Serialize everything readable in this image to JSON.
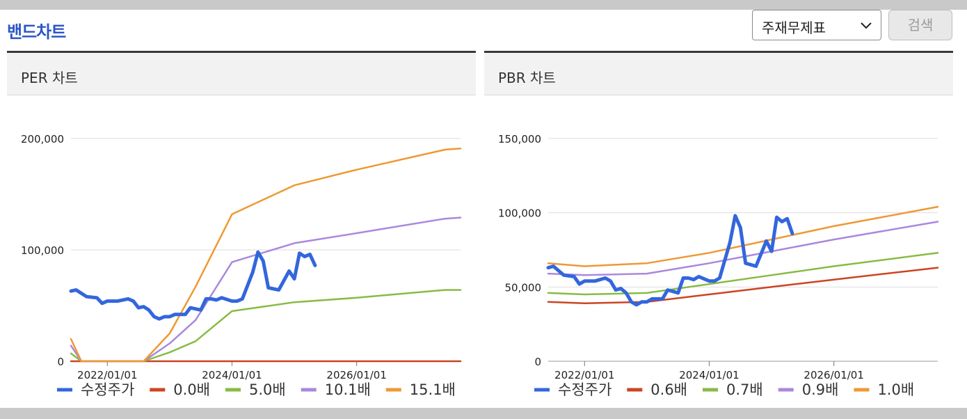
{
  "header": {
    "title": "밴드차트",
    "select_value": "주재무제표",
    "search_label": "검색"
  },
  "colors": {
    "price": "#3366dd",
    "band1": "#cc4422",
    "band2": "#88bb44",
    "band3": "#aa88dd",
    "band4": "#ee9933"
  },
  "chart_data": [
    {
      "type": "line",
      "title": "PER 차트",
      "x_ticks": [
        "2022/01/01",
        "2024/01/01",
        "2026/01/01"
      ],
      "y_ticks": [
        "0",
        "100,000",
        "200,000"
      ],
      "ylim": [
        0,
        200000
      ],
      "xlim": [
        "2021-06",
        "2027-09"
      ],
      "grid": true,
      "legend_position": "bottom",
      "series": [
        {
          "name": "수정주가",
          "color_key": "price",
          "points": [
            [
              "2021-06",
              63000
            ],
            [
              "2021-07",
              64000
            ],
            [
              "2021-08",
              61000
            ],
            [
              "2021-09",
              58000
            ],
            [
              "2021-11",
              57000
            ],
            [
              "2021-12",
              52000
            ],
            [
              "2022-01",
              54000
            ],
            [
              "2022-03",
              54000
            ],
            [
              "2022-05",
              56000
            ],
            [
              "2022-06",
              54000
            ],
            [
              "2022-07",
              48000
            ],
            [
              "2022-08",
              49000
            ],
            [
              "2022-09",
              46000
            ],
            [
              "2022-10",
              40000
            ],
            [
              "2022-11",
              38000
            ],
            [
              "2022-12",
              40000
            ],
            [
              "2023-01",
              40000
            ],
            [
              "2023-02",
              42000
            ],
            [
              "2023-04",
              42000
            ],
            [
              "2023-05",
              48000
            ],
            [
              "2023-06",
              47000
            ],
            [
              "2023-07",
              46000
            ],
            [
              "2023-08",
              56000
            ],
            [
              "2023-09",
              56000
            ],
            [
              "2023-10",
              55000
            ],
            [
              "2023-11",
              57000
            ],
            [
              "2024-01",
              54000
            ],
            [
              "2024-02",
              54000
            ],
            [
              "2024-03",
              56000
            ],
            [
              "2024-05",
              80000
            ],
            [
              "2024-06",
              98000
            ],
            [
              "2024-07",
              90000
            ],
            [
              "2024-08",
              66000
            ],
            [
              "2024-09",
              65000
            ],
            [
              "2024-10",
              64000
            ],
            [
              "2024-12",
              81000
            ],
            [
              "2025-01",
              74000
            ],
            [
              "2025-02",
              97000
            ],
            [
              "2025-03",
              94000
            ],
            [
              "2025-04",
              96000
            ],
            [
              "2025-05",
              86000
            ]
          ]
        },
        {
          "name": "0.0배",
          "color_key": "band1",
          "points": [
            [
              "2021-06",
              0
            ],
            [
              "2027-09",
              0
            ]
          ]
        },
        {
          "name": "5.0배",
          "color_key": "band2",
          "points": [
            [
              "2021-06",
              7000
            ],
            [
              "2021-08",
              0
            ],
            [
              "2022-08",
              0
            ],
            [
              "2023-01",
              8000
            ],
            [
              "2023-06",
              18000
            ],
            [
              "2024-01",
              45000
            ],
            [
              "2025-01",
              53000
            ],
            [
              "2026-01",
              57000
            ],
            [
              "2027-06",
              64000
            ],
            [
              "2027-09",
              64000
            ]
          ]
        },
        {
          "name": "10.1배",
          "color_key": "band3",
          "points": [
            [
              "2021-06",
              14000
            ],
            [
              "2021-08",
              0
            ],
            [
              "2022-08",
              0
            ],
            [
              "2023-01",
              16000
            ],
            [
              "2023-06",
              37000
            ],
            [
              "2024-01",
              89000
            ],
            [
              "2025-01",
              106000
            ],
            [
              "2026-01",
              115000
            ],
            [
              "2027-06",
              128000
            ],
            [
              "2027-09",
              129000
            ]
          ]
        },
        {
          "name": "15.1배",
          "color_key": "band4",
          "points": [
            [
              "2021-06",
              20000
            ],
            [
              "2021-08",
              0
            ],
            [
              "2022-08",
              0
            ],
            [
              "2023-01",
              25000
            ],
            [
              "2023-06",
              67000
            ],
            [
              "2024-01",
              132000
            ],
            [
              "2025-01",
              158000
            ],
            [
              "2026-01",
              172000
            ],
            [
              "2027-06",
              190000
            ],
            [
              "2027-09",
              191000
            ]
          ]
        }
      ]
    },
    {
      "type": "line",
      "title": "PBR 차트",
      "x_ticks": [
        "2022/01/01",
        "2024/01/01",
        "2026/01/01"
      ],
      "y_ticks": [
        "0",
        "50,000",
        "100,000",
        "150,000"
      ],
      "ylim": [
        0,
        150000
      ],
      "xlim": [
        "2021-06",
        "2027-09"
      ],
      "grid": true,
      "legend_position": "bottom",
      "series": [
        {
          "name": "수정주가",
          "color_key": "price",
          "points": [
            [
              "2021-06",
              63000
            ],
            [
              "2021-07",
              64000
            ],
            [
              "2021-08",
              61000
            ],
            [
              "2021-09",
              58000
            ],
            [
              "2021-11",
              57000
            ],
            [
              "2021-12",
              52000
            ],
            [
              "2022-01",
              54000
            ],
            [
              "2022-03",
              54000
            ],
            [
              "2022-05",
              56000
            ],
            [
              "2022-06",
              54000
            ],
            [
              "2022-07",
              48000
            ],
            [
              "2022-08",
              49000
            ],
            [
              "2022-09",
              46000
            ],
            [
              "2022-10",
              40000
            ],
            [
              "2022-11",
              38000
            ],
            [
              "2022-12",
              40000
            ],
            [
              "2023-01",
              40000
            ],
            [
              "2023-02",
              42000
            ],
            [
              "2023-04",
              42000
            ],
            [
              "2023-05",
              48000
            ],
            [
              "2023-06",
              47000
            ],
            [
              "2023-07",
              46000
            ],
            [
              "2023-08",
              56000
            ],
            [
              "2023-09",
              56000
            ],
            [
              "2023-10",
              55000
            ],
            [
              "2023-11",
              57000
            ],
            [
              "2024-01",
              54000
            ],
            [
              "2024-02",
              54000
            ],
            [
              "2024-03",
              56000
            ],
            [
              "2024-05",
              80000
            ],
            [
              "2024-06",
              98000
            ],
            [
              "2024-07",
              90000
            ],
            [
              "2024-08",
              66000
            ],
            [
              "2024-09",
              65000
            ],
            [
              "2024-10",
              64000
            ],
            [
              "2024-12",
              81000
            ],
            [
              "2025-01",
              74000
            ],
            [
              "2025-02",
              97000
            ],
            [
              "2025-03",
              94000
            ],
            [
              "2025-04",
              96000
            ],
            [
              "2025-05",
              86000
            ]
          ]
        },
        {
          "name": "0.6배",
          "color_key": "band1",
          "points": [
            [
              "2021-06",
              40000
            ],
            [
              "2022-01",
              39000
            ],
            [
              "2023-01",
              40000
            ],
            [
              "2024-01",
              45000
            ],
            [
              "2025-01",
              50000
            ],
            [
              "2026-01",
              55000
            ],
            [
              "2027-09",
              63000
            ]
          ]
        },
        {
          "name": "0.7배",
          "color_key": "band2",
          "points": [
            [
              "2021-06",
              46000
            ],
            [
              "2022-01",
              45000
            ],
            [
              "2023-01",
              46000
            ],
            [
              "2024-01",
              52000
            ],
            [
              "2025-01",
              58000
            ],
            [
              "2026-01",
              64000
            ],
            [
              "2027-09",
              73000
            ]
          ]
        },
        {
          "name": "0.9배",
          "color_key": "band3",
          "points": [
            [
              "2021-06",
              59000
            ],
            [
              "2022-01",
              58000
            ],
            [
              "2023-01",
              59000
            ],
            [
              "2024-01",
              66000
            ],
            [
              "2025-01",
              74000
            ],
            [
              "2026-01",
              82000
            ],
            [
              "2027-09",
              94000
            ]
          ]
        },
        {
          "name": "1.0배",
          "color_key": "band4",
          "points": [
            [
              "2021-06",
              66000
            ],
            [
              "2022-01",
              64000
            ],
            [
              "2023-01",
              66000
            ],
            [
              "2024-01",
              73000
            ],
            [
              "2025-01",
              82000
            ],
            [
              "2026-01",
              91000
            ],
            [
              "2027-09",
              104000
            ]
          ]
        }
      ]
    }
  ]
}
